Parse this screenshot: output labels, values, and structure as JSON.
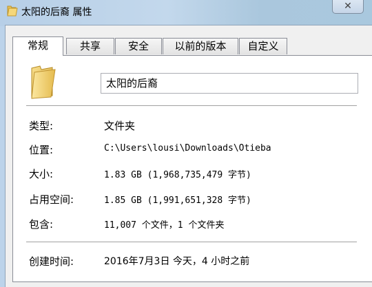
{
  "window": {
    "title": "太阳的后裔 属性",
    "close_glyph": "✕"
  },
  "tabs": [
    {
      "label": "常规",
      "active": true
    },
    {
      "label": "共享",
      "active": false
    },
    {
      "label": "安全",
      "active": false
    },
    {
      "label": "以前的版本",
      "active": false
    },
    {
      "label": "自定义",
      "active": false
    }
  ],
  "general": {
    "folder_name": "太阳的后裔",
    "fields": [
      {
        "label": "类型:",
        "value": "文件夹"
      },
      {
        "label": "位置:",
        "value": "C:\\Users\\lousi\\Downloads\\Otieba"
      },
      {
        "label": "大小:",
        "value": "1.83 GB (1,968,735,479 字节)"
      },
      {
        "label": "占用空间:",
        "value": "1.85 GB (1,991,651,328 字节)"
      },
      {
        "label": "包含:",
        "value": "11,007 个文件，1 个文件夹"
      }
    ],
    "created": {
      "label": "创建时间:",
      "value": "2016年7月3日 今天，4 小时之前"
    }
  },
  "icons": {
    "title_icon": "folder-icon",
    "big_icon": "folder-icon",
    "close": "close-icon"
  }
}
